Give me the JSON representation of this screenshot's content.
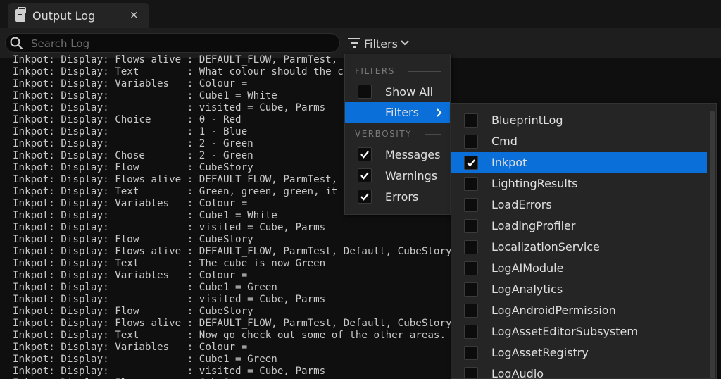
{
  "tab": {
    "title": "Output Log",
    "close": "×",
    "icon": "terminal-doc-icon"
  },
  "search": {
    "placeholder": "Search Log",
    "value": ""
  },
  "toolbar": {
    "filters_label": "Filters"
  },
  "log_lines": [
    "Inkpot: Display: Flows alive : DEFAULT_FLOW, ParmTest, CubeStory,",
    "Inkpot: Display: Text        : What colour should the cube be?",
    "Inkpot: Display: Variables   : Colour =",
    "Inkpot: Display:             : Cube1 = White",
    "Inkpot: Display:             : visited = Cube, Parms",
    "Inkpot: Display: Choice      : 0 - Red",
    "Inkpot: Display:             : 1 - Blue",
    "Inkpot: Display:             : 2 - Green",
    "Inkpot: Display: Chose       : 2 - Green",
    "Inkpot: Display: Flow        : CubeStory",
    "Inkpot: Display: Flows alive : DEFAULT_FLOW, ParmTest, Default, CubeStory,",
    "Inkpot: Display: Text        : Green, green, green, it is!",
    "Inkpot: Display: Variables   : Colour =",
    "Inkpot: Display:             : Cube1 = White",
    "Inkpot: Display:             : visited = Cube, Parms",
    "Inkpot: Display: Flow        : CubeStory",
    "Inkpot: Display: Flows alive : DEFAULT_FLOW, ParmTest, Default, CubeStory,",
    "Inkpot: Display: Text        : The cube is now Green",
    "Inkpot: Display: Variables   : Colour =",
    "Inkpot: Display:             : Cube1 = Green",
    "Inkpot: Display:             : visited = Cube, Parms",
    "Inkpot: Display: Flow        : CubeStory",
    "Inkpot: Display: Flows alive : DEFAULT_FLOW, ParmTest, Default, CubeStory,",
    "Inkpot: Display: Text        : Now go check out some of the other areas.",
    "Inkpot: Display: Variables   : Colour =",
    "Inkpot: Display:             : Cube1 = Green",
    "Inkpot: Display:             : visited = Cube, Parms",
    "Inkpot: Display: Flow        : CubeStory"
  ],
  "menu": {
    "filters_section": "FILTERS",
    "show_all": {
      "label": "Show All",
      "checked": false
    },
    "filters": {
      "label": "Filters"
    },
    "verbosity_section": "VERBOSITY",
    "verbosity": [
      {
        "label": "Messages",
        "checked": true
      },
      {
        "label": "Warnings",
        "checked": true
      },
      {
        "label": "Errors",
        "checked": true
      }
    ]
  },
  "categories": [
    {
      "label": "BlueprintLog",
      "checked": false
    },
    {
      "label": "Cmd",
      "checked": false
    },
    {
      "label": "Inkpot",
      "checked": true,
      "highlighted": true
    },
    {
      "label": "LightingResults",
      "checked": false
    },
    {
      "label": "LoadErrors",
      "checked": false
    },
    {
      "label": "LoadingProfiler",
      "checked": false
    },
    {
      "label": "LocalizationService",
      "checked": false
    },
    {
      "label": "LogAIModule",
      "checked": false
    },
    {
      "label": "LogAnalytics",
      "checked": false
    },
    {
      "label": "LogAndroidPermission",
      "checked": false
    },
    {
      "label": "LogAssetEditorSubsystem",
      "checked": false
    },
    {
      "label": "LogAssetRegistry",
      "checked": false
    },
    {
      "label": "LogAudio",
      "checked": false
    }
  ],
  "colors": {
    "highlight": "#0a6fd8",
    "background": "#0f0f0f",
    "panel": "#252525"
  }
}
